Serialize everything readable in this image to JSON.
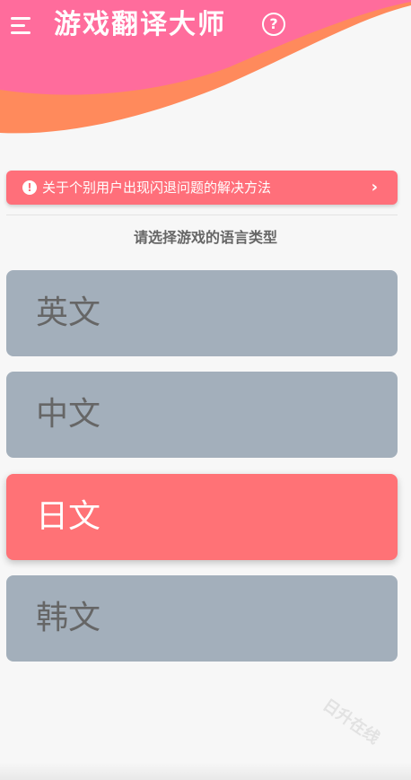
{
  "header": {
    "title": "游戏翻译大师",
    "menu_icon": "menu-icon",
    "help_icon": "help-circle-icon",
    "help_glyph": "?"
  },
  "notice": {
    "icon": "exclamation-circle-icon",
    "icon_glyph": "!",
    "text": "关于个别用户出现闪退问题的解决方法",
    "chevron": "›"
  },
  "section": {
    "title": "请选择游戏的语言类型"
  },
  "languages": [
    {
      "label": "英文",
      "selected": false
    },
    {
      "label": "中文",
      "selected": false
    },
    {
      "label": "日文",
      "selected": true
    },
    {
      "label": "韩文",
      "selected": false
    }
  ],
  "watermark": "日升在线",
  "colors": {
    "accent_pink": "#ff6f7a",
    "header_pink": "#ff6c9c",
    "header_orange": "#ff8a5c",
    "card_grey": "#a3afbb",
    "card_selected": "#ff7276"
  }
}
